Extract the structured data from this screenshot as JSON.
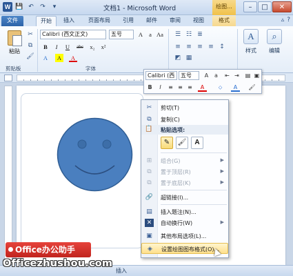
{
  "titlebar": {
    "title": "文档1 - Microsoft Word",
    "context_group": "绘图...",
    "minimize": "–",
    "maximize": "□",
    "close": "✕"
  },
  "tabs": [
    "文件",
    "开始",
    "插入",
    "页面布局",
    "引用",
    "邮件",
    "审阅",
    "视图",
    "格式"
  ],
  "ribbon": {
    "clipboard": {
      "paste": "粘贴",
      "group": "剪贴板"
    },
    "font": {
      "font_name": "Calibri (西文正文)",
      "font_size": "五号",
      "group": "字体",
      "buttons": [
        "B",
        "I",
        "U",
        "abc",
        "x₂",
        "x²",
        "A",
        "A",
        "A"
      ]
    },
    "style": {
      "label": "样式"
    },
    "edit": {
      "label": "编辑"
    }
  },
  "mini_toolbar": {
    "font_name": "Calibri (西",
    "font_size": "五号",
    "row2": [
      "B",
      "I",
      "≡",
      "≡",
      "≡",
      "A",
      "⬦",
      "A",
      "🖌"
    ]
  },
  "context_menu": {
    "cut": "剪切(T)",
    "copy": "复制(C)",
    "paste_options": "粘贴选项:",
    "group": "组合(G)",
    "bring_front": "置于顶层(R)",
    "send_back": "置于底层(K)",
    "hyperlink": "超链接(I)...",
    "insert_caption": "插入题注(N)...",
    "wrap_text": "自动换行(W)",
    "more_layout": "其他布局选项(L)...",
    "format_shape": "设置绘图图布格式(O)..."
  },
  "statusbar": {
    "mode": "插入"
  },
  "watermark": {
    "badge": "Office办公助手",
    "site": "Officezhushou.com"
  },
  "colors": {
    "smiley_fill": "#4a7fbf",
    "smiley_stroke": "#2f5d93",
    "menu_highlight": "#ffe08c",
    "badge_red": "#d0302a"
  }
}
